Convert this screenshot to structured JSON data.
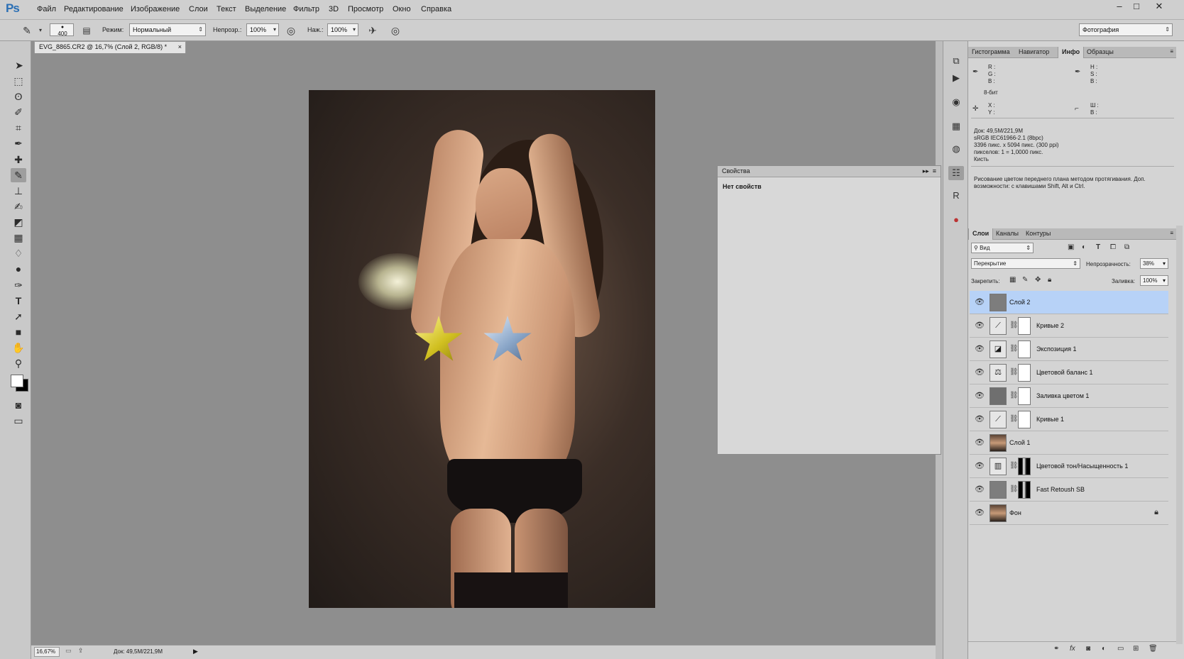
{
  "app": {
    "logo": "Ps"
  },
  "menu": [
    "Файл",
    "Редактирование",
    "Изображение",
    "Слои",
    "Текст",
    "Выделение",
    "Фильтр",
    "3D",
    "Просмотр",
    "Окно",
    "Справка"
  ],
  "window_controls": {
    "minimize": "–",
    "maximize": "□",
    "close": "✕"
  },
  "options": {
    "brush_size": "400",
    "mode_label": "Режим:",
    "mode_value": "Нормальный",
    "opacity_label": "Непрозр.:",
    "opacity_value": "100%",
    "pressure_label": "Наж.:",
    "pressure_value": "100%",
    "workspace": "Фотография"
  },
  "document": {
    "tab_title": "EVG_8865.CR2 @ 16,7% (Слой 2, RGB/8) *",
    "tab_close": "×"
  },
  "status": {
    "zoom": "16,67%",
    "doc_size": "Док: 49,5M/221,9M"
  },
  "properties": {
    "title": "Свойства",
    "empty_text": "Нет свойств"
  },
  "info_panel": {
    "tabs": [
      "Гистограмма",
      "Навигатор",
      "Инфо",
      "Образцы"
    ],
    "active_tab": "Инфо",
    "rgb_labels": "R :\nG :\nB :",
    "hsb_labels": "H :\nS :\nB :",
    "bit_depth": "8-бит",
    "xy_labels": "X :\nY :",
    "wh_labels": "Ш :\nВ :",
    "doc_info": "Док: 49,5M/221,9M\nsRGB IEC61966-2.1 (8bpc)\n3396 пикс. x 5094 пикс. (300 ppi)\nпикселов: 1 = 1,0000 пикс.\nКисть",
    "hint": "Рисование цветом переднего плана методом протягивания. Доп. возможности: с клавишами Shift, Alt и Ctrl."
  },
  "layers_panel": {
    "tabs": [
      "Слои",
      "Каналы",
      "Контуры"
    ],
    "active_tab": "Слои",
    "filter_value": "Вид",
    "blend_mode": "Перекрытие",
    "opacity_label": "Непрозрачность:",
    "opacity_value": "38%",
    "lock_label": "Закрепить:",
    "fill_label": "Заливка:",
    "fill_value": "100%",
    "layers": [
      {
        "name": "Слой 2",
        "kind": "gray",
        "mask": false,
        "selected": true
      },
      {
        "name": "Кривые 2",
        "kind": "curves",
        "mask": true,
        "selected": false
      },
      {
        "name": "Экспозиция 1",
        "kind": "exposure",
        "mask": true,
        "selected": false
      },
      {
        "name": "Цветовой баланс 1",
        "kind": "balance",
        "mask": true,
        "selected": false
      },
      {
        "name": "Заливка цветом 1",
        "kind": "fill",
        "mask": true,
        "selected": false
      },
      {
        "name": "Кривые 1",
        "kind": "curves",
        "mask": true,
        "selected": false
      },
      {
        "name": "Слой 1",
        "kind": "photo",
        "mask": false,
        "selected": false
      },
      {
        "name": "Цветовой тон/Насыщенность 1",
        "kind": "huesat",
        "mask": true,
        "selected": false
      },
      {
        "name": "Fast Retoush SB",
        "kind": "gray",
        "mask": true,
        "selected": false
      },
      {
        "name": "Фон",
        "kind": "photo",
        "mask": false,
        "selected": false,
        "locked": true
      }
    ]
  }
}
